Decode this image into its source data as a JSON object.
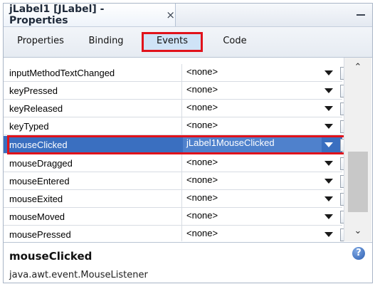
{
  "title": {
    "text": "jLabel1 [JLabel] - Properties",
    "close_glyph": "×"
  },
  "tabs": [
    {
      "label": "Properties",
      "active": false
    },
    {
      "label": "Binding",
      "active": false
    },
    {
      "label": "Events",
      "active": true
    },
    {
      "label": "Code",
      "active": false
    }
  ],
  "events": [
    {
      "name": "inputMethodTextChanged",
      "value": "<none>"
    },
    {
      "name": "keyPressed",
      "value": "<none>"
    },
    {
      "name": "keyReleased",
      "value": "<none>"
    },
    {
      "name": "keyTyped",
      "value": "<none>"
    },
    {
      "name": "mouseClicked",
      "value": "jLabel1MouseClicked",
      "selected": true
    },
    {
      "name": "mouseDragged",
      "value": "<none>"
    },
    {
      "name": "mouseEntered",
      "value": "<none>"
    },
    {
      "name": "mouseExited",
      "value": "<none>"
    },
    {
      "name": "mouseMoved",
      "value": "<none>"
    },
    {
      "name": "mousePressed",
      "value": "<none>"
    }
  ],
  "ellipsis_label": "...",
  "description": {
    "title": "mouseClicked",
    "text": "java.awt.event.MouseListener"
  },
  "icons": {
    "close": "close-icon",
    "minimize": "minimize-icon",
    "dropdown": "dropdown-arrow-icon",
    "help": "help-icon"
  },
  "colors": {
    "selection": "#3a6fc0",
    "highlight": "#e1121b",
    "active_tab": "#cfe3f7"
  }
}
